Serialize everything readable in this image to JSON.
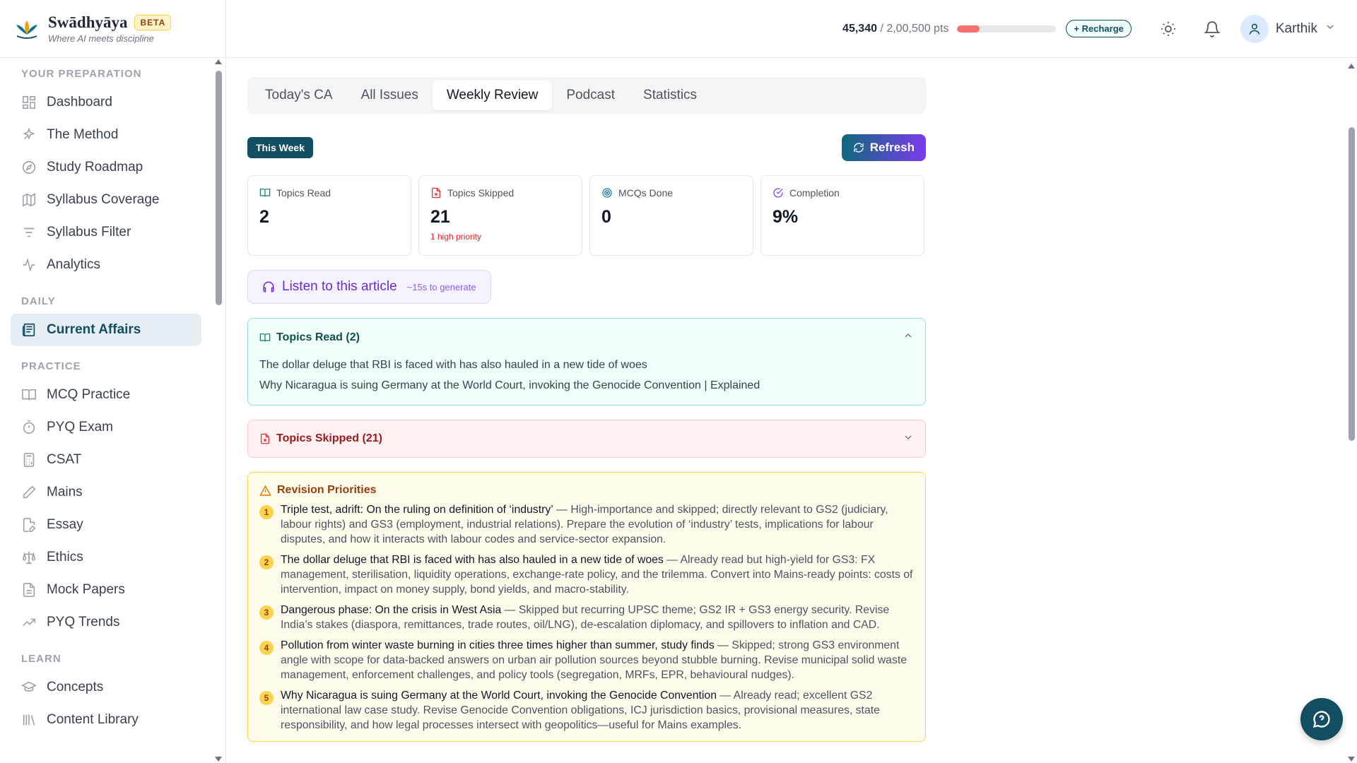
{
  "brand": {
    "name": "Swādhyāya",
    "badge": "BETA",
    "tagline": "Where AI meets discipline"
  },
  "header": {
    "points_current": "45,340",
    "points_total": "/ 2,00,500 pts",
    "points_fraction": 0.226,
    "recharge_label": "+ Recharge",
    "user_name": "Karthik"
  },
  "sidebar": {
    "sections": [
      {
        "title": "YOUR PREPARATION",
        "items": [
          {
            "label": "Dashboard",
            "icon": "dashboard-icon"
          },
          {
            "label": "The Method",
            "icon": "sparkles-icon"
          },
          {
            "label": "Study Roadmap",
            "icon": "compass-icon"
          },
          {
            "label": "Syllabus Coverage",
            "icon": "map-icon"
          },
          {
            "label": "Syllabus Filter",
            "icon": "filter-icon"
          },
          {
            "label": "Analytics",
            "icon": "activity-icon"
          }
        ]
      },
      {
        "title": "DAILY",
        "items": [
          {
            "label": "Current Affairs",
            "icon": "newspaper-icon",
            "active": true
          }
        ]
      },
      {
        "title": "PRACTICE",
        "items": [
          {
            "label": "MCQ Practice",
            "icon": "book-open-icon"
          },
          {
            "label": "PYQ Exam",
            "icon": "timer-icon"
          },
          {
            "label": "CSAT",
            "icon": "calculator-icon"
          },
          {
            "label": "Mains",
            "icon": "pen-icon"
          },
          {
            "label": "Essay",
            "icon": "file-pen-icon"
          },
          {
            "label": "Ethics",
            "icon": "scale-icon"
          },
          {
            "label": "Mock Papers",
            "icon": "file-text-icon"
          },
          {
            "label": "PYQ Trends",
            "icon": "trending-icon"
          }
        ]
      },
      {
        "title": "LEARN",
        "items": [
          {
            "label": "Concepts",
            "icon": "graduation-cap-icon"
          },
          {
            "label": "Content Library",
            "icon": "library-icon"
          }
        ]
      }
    ]
  },
  "tabs": [
    {
      "label": "Today's CA"
    },
    {
      "label": "All Issues"
    },
    {
      "label": "Weekly Review",
      "active": true
    },
    {
      "label": "Podcast"
    },
    {
      "label": "Statistics"
    }
  ],
  "week_badge": "This Week",
  "refresh_label": "Refresh",
  "stats": [
    {
      "label": "Topics Read",
      "value": "2",
      "note": "",
      "icon": "book-open-icon",
      "color": "#0f766e"
    },
    {
      "label": "Topics Skipped",
      "value": "21",
      "note": "1 high priority",
      "icon": "file-x-icon",
      "color": "#dc2626"
    },
    {
      "label": "MCQs Done",
      "value": "0",
      "note": "",
      "icon": "target-icon",
      "color": "#0e7490"
    },
    {
      "label": "Completion",
      "value": "9%",
      "note": "",
      "icon": "check-circle-icon",
      "color": "#7c3aed"
    }
  ],
  "listen": {
    "label": "Listen to this article",
    "note": "~15s to generate"
  },
  "topics_read": {
    "title": "Topics Read (2)",
    "items": [
      "The dollar deluge that RBI is faced with has also hauled in a new tide of woes",
      "Why Nicaragua is suing Germany at the World Court, invoking the Genocide Convention | Explained"
    ]
  },
  "topics_skipped": {
    "title": "Topics Skipped (21)"
  },
  "priorities": {
    "title": "Revision Priorities",
    "items": [
      {
        "num": "1",
        "head": "Triple test, adrift: On the ruling on definition of ‘industry’",
        "body": " — High-importance and skipped; directly relevant to GS2 (judiciary, labour rights) and GS3 (employment, industrial relations). Prepare the evolution of ‘industry’ tests, implications for labour disputes, and how it interacts with labour codes and service-sector expansion."
      },
      {
        "num": "2",
        "head": "The dollar deluge that RBI is faced with has also hauled in a new tide of woes",
        "body": " — Already read but high-yield for GS3: FX management, sterilisation, liquidity operations, exchange-rate policy, and the trilemma. Convert into Mains-ready points: costs of intervention, impact on money supply, bond yields, and macro-stability."
      },
      {
        "num": "3",
        "head": "Dangerous phase: On the crisis in West Asia",
        "body": " — Skipped but recurring UPSC theme; GS2 IR + GS3 energy security. Revise India’s stakes (diaspora, remittances, trade routes, oil/LNG), de-escalation diplomacy, and spillovers to inflation and CAD."
      },
      {
        "num": "4",
        "head": "Pollution from winter waste burning in cities three times higher than summer, study finds",
        "body": " — Skipped; strong GS3 environment angle with scope for data-backed answers on urban air pollution sources beyond stubble burning. Revise municipal solid waste management, enforcement challenges, and policy tools (segregation, MRFs, EPR, behavioural nudges)."
      },
      {
        "num": "5",
        "head": "Why Nicaragua is suing Germany at the World Court, invoking the Genocide Convention",
        "body": " — Already read; excellent GS2 international law case study. Revise Genocide Convention obligations, ICJ jurisdiction basics, provisional measures, state responsibility, and how legal processes intersect with geopolitics—useful for Mains examples."
      }
    ]
  },
  "colors": {
    "brand_teal": "#134e63",
    "accent_purple": "#7c3aed"
  }
}
